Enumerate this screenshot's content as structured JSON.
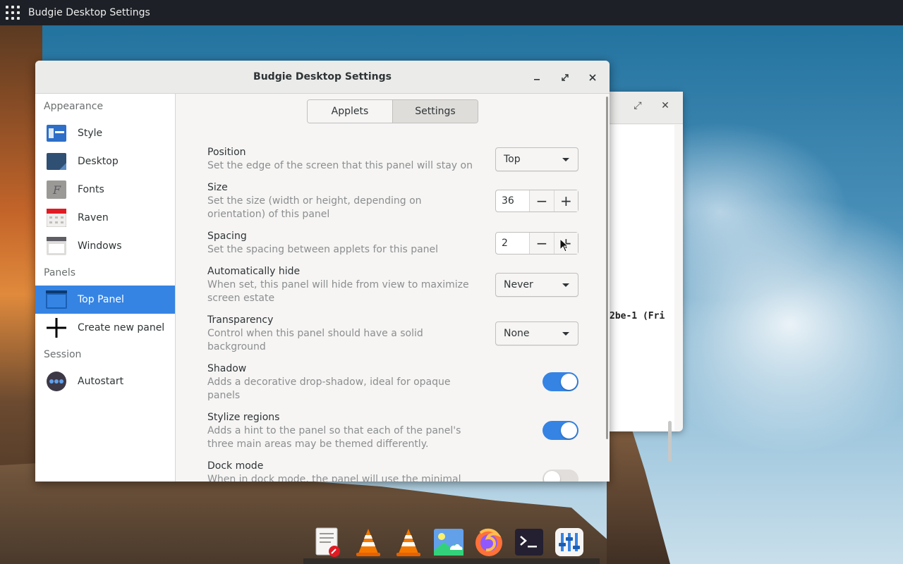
{
  "top_panel": {
    "title": "Budgie Desktop Settings"
  },
  "background_window": {
    "terminal_text": "2be-1 (Fri"
  },
  "window": {
    "title": "Budgie Desktop Settings",
    "minimize_label": "–",
    "maximize_label": "⤢",
    "close_label": "✕"
  },
  "sidebar": {
    "sections": {
      "appearance": "Appearance",
      "panels": "Panels",
      "session": "Session"
    },
    "items": {
      "style": "Style",
      "desktop": "Desktop",
      "fonts": "Fonts",
      "raven": "Raven",
      "windows": "Windows",
      "top_panel": "Top Panel",
      "create_panel": "Create new panel",
      "autostart": "Autostart"
    },
    "active_item": "Top Panel"
  },
  "tabs": {
    "applets": "Applets",
    "settings": "Settings",
    "active": "Settings"
  },
  "settings": {
    "position": {
      "title": "Position",
      "desc": "Set the edge of the screen that this panel will stay on",
      "value": "Top"
    },
    "size": {
      "title": "Size",
      "desc1": "Set the size (width or height, depending on",
      "desc2": "orientation) of this panel",
      "value": "36"
    },
    "spacing": {
      "title": "Spacing",
      "desc": "Set the spacing between applets for this panel",
      "value": "2"
    },
    "autohide": {
      "title": "Automatically hide",
      "desc1": "When set, this panel will hide from view to maximize",
      "desc2": "screen estate",
      "value": "Never"
    },
    "transparency": {
      "title": "Transparency",
      "desc1": "Control when this panel should have a solid",
      "desc2": "background",
      "value": "None"
    },
    "shadow": {
      "title": "Shadow",
      "desc1": "Adds a decorative drop-shadow, ideal for opaque",
      "desc2": "panels",
      "enabled": true
    },
    "stylize": {
      "title": "Stylize regions",
      "desc1": "Adds a hint to the panel so that each of the panel's",
      "desc2": "three main areas may be themed differently.",
      "enabled": true
    },
    "dock": {
      "title": "Dock mode",
      "desc1": "When in dock mode, the panel will use the minimal",
      "enabled": false
    }
  },
  "spin_labels": {
    "minus": "−",
    "plus": "+"
  },
  "dock": {
    "items": [
      "text-editor-icon",
      "vlc-icon",
      "vlc-icon",
      "image-viewer-icon",
      "firefox-icon",
      "terminal-icon",
      "settings-tool-icon"
    ]
  },
  "colors": {
    "accent": "#3584e4",
    "panel": "#1d2026"
  }
}
